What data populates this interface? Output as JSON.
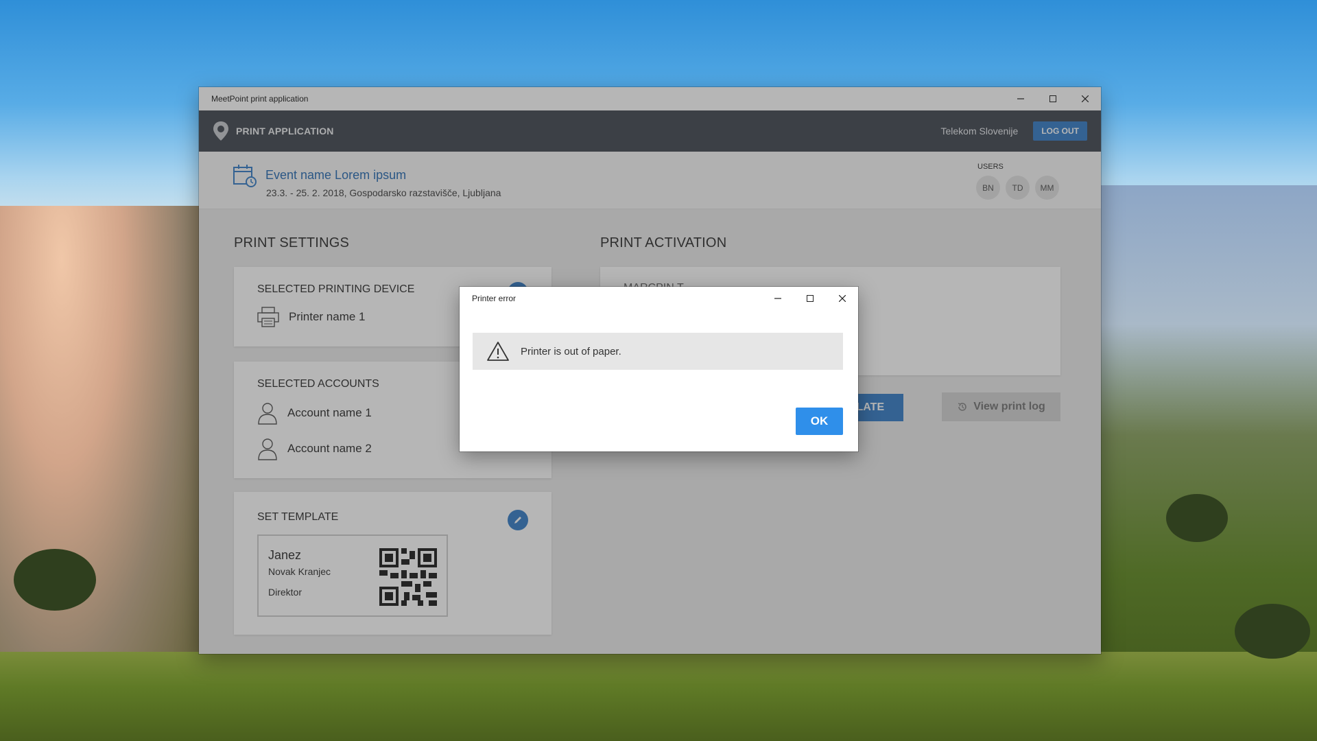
{
  "window": {
    "title": "MeetPoint print application"
  },
  "header": {
    "app_title": "PRINT APPLICATION",
    "organization": "Telekom Slovenije",
    "logout_label": "LOG OUT"
  },
  "event": {
    "name": "Event name Lorem ipsum",
    "details": "23.3. - 25. 2. 2018, Gospodarsko razstavišče, Ljubljana",
    "users_label": "USERS",
    "users": [
      "BN",
      "TD",
      "MM"
    ]
  },
  "print_settings": {
    "title": "PRINT SETTINGS",
    "device": {
      "title": "SELECTED PRINTING DEVICE",
      "printer": "Printer name 1"
    },
    "accounts": {
      "title": "SELECTED ACCOUNTS",
      "items": [
        "Account name 1",
        "Account name 2"
      ]
    },
    "template": {
      "title": "SET TEMPLATE",
      "first_name": "Janez",
      "last_name": "Novak Kranjec",
      "role": "Direktor"
    }
  },
  "print_activation": {
    "title": "PRINT ACTIVATION",
    "partial_label": "MARCPIN T",
    "template_button_partial": "PLATE",
    "view_log_label": "View print log"
  },
  "dialog": {
    "title": "Printer error",
    "message": "Printer is out of paper.",
    "ok_label": "OK"
  },
  "colors": {
    "accent": "#3a80c8",
    "header_bg": "#474c55",
    "ok_button": "#2f8fea"
  }
}
